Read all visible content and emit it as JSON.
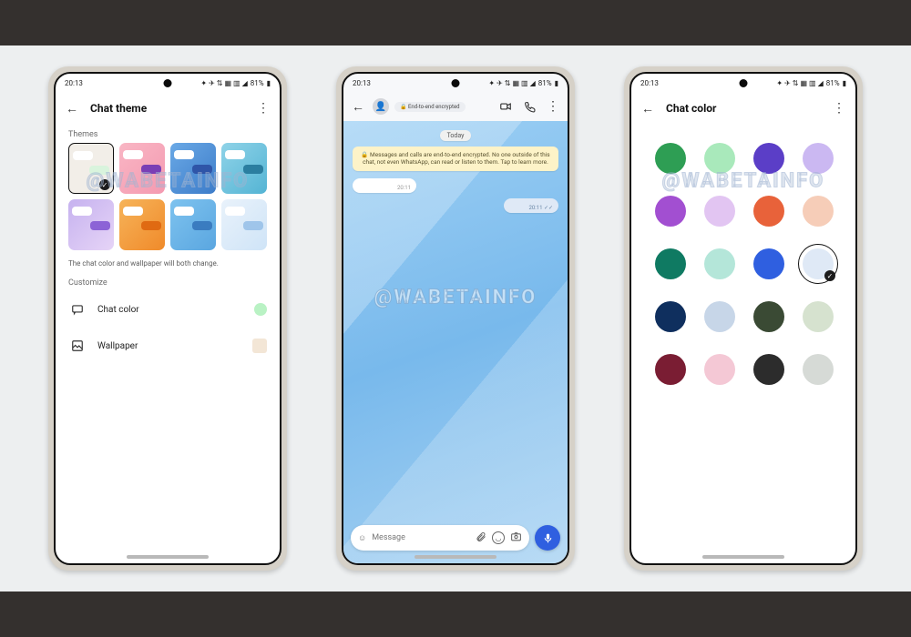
{
  "watermark": "@WABETAINFO",
  "status": {
    "time": "20:13",
    "battery": "81%",
    "icons": "✦ ✈ ⇅ ▦ ▥ ◢"
  },
  "screen1": {
    "title": "Chat theme",
    "themes_label": "Themes",
    "hint": "The chat color and wallpaper will both change.",
    "customize_label": "Customize",
    "rows": {
      "chat_color": "Chat color",
      "wallpaper": "Wallpaper"
    },
    "chat_color_swatch": "#b9f2c4",
    "wallpaper_swatch": "#f3e6d6",
    "tiles": [
      {
        "bg": "#f2eee8",
        "accent": "#d9f4dd",
        "selected": true
      },
      {
        "bg": "linear-gradient(135deg,#f9b6c4,#f49ab1)",
        "accent": "#7a3fb5"
      },
      {
        "bg": "linear-gradient(135deg,#6aa9e6,#3d7cc9)",
        "accent": "#2f55a8"
      },
      {
        "bg": "linear-gradient(135deg,#8fd3e8,#54b4d4)",
        "accent": "#2b7ea0"
      },
      {
        "bg": "linear-gradient(135deg,#c6b2ef,#e6d4f7)",
        "accent": "#8c63d6"
      },
      {
        "bg": "linear-gradient(135deg,#f6b45a,#f08a2a)",
        "accent": "#e06a12"
      },
      {
        "bg": "linear-gradient(135deg,#7ec3ef,#5aa6e0)",
        "accent": "#3a7cc0"
      },
      {
        "bg": "linear-gradient(135deg,#e9f2fb,#cfe4f7)",
        "accent": "#9fc5ea"
      }
    ]
  },
  "screen2": {
    "encryption_chip": "End-to-end encrypted",
    "date": "Today",
    "notice": "🔒 Messages and calls are end-to-end encrypted. No one outside of this chat, not even WhatsApp, can read or listen to them. Tap to learn more.",
    "msg_in_time": "20:11",
    "msg_out_time": "20:11 ✓✓",
    "composer_placeholder": "Message"
  },
  "screen3": {
    "title": "Chat color",
    "colors": [
      "#2e9e54",
      "#a9e9bb",
      "#5b3ec7",
      "#cbb8f2",
      "#a24fd1",
      "#e2c5f2",
      "#e8623a",
      "#f6cdb8",
      "#0f7a62",
      "#b4e6d9",
      "#2f5fe0",
      "#dfe9f6",
      "#0f2f5e",
      "#c7d6e8",
      "#3a4a34",
      "#d6e2cf",
      "#7a1d33",
      "#f4c8d5",
      "#2c2c2c",
      "#d6dad6"
    ],
    "selected_index": 11
  }
}
